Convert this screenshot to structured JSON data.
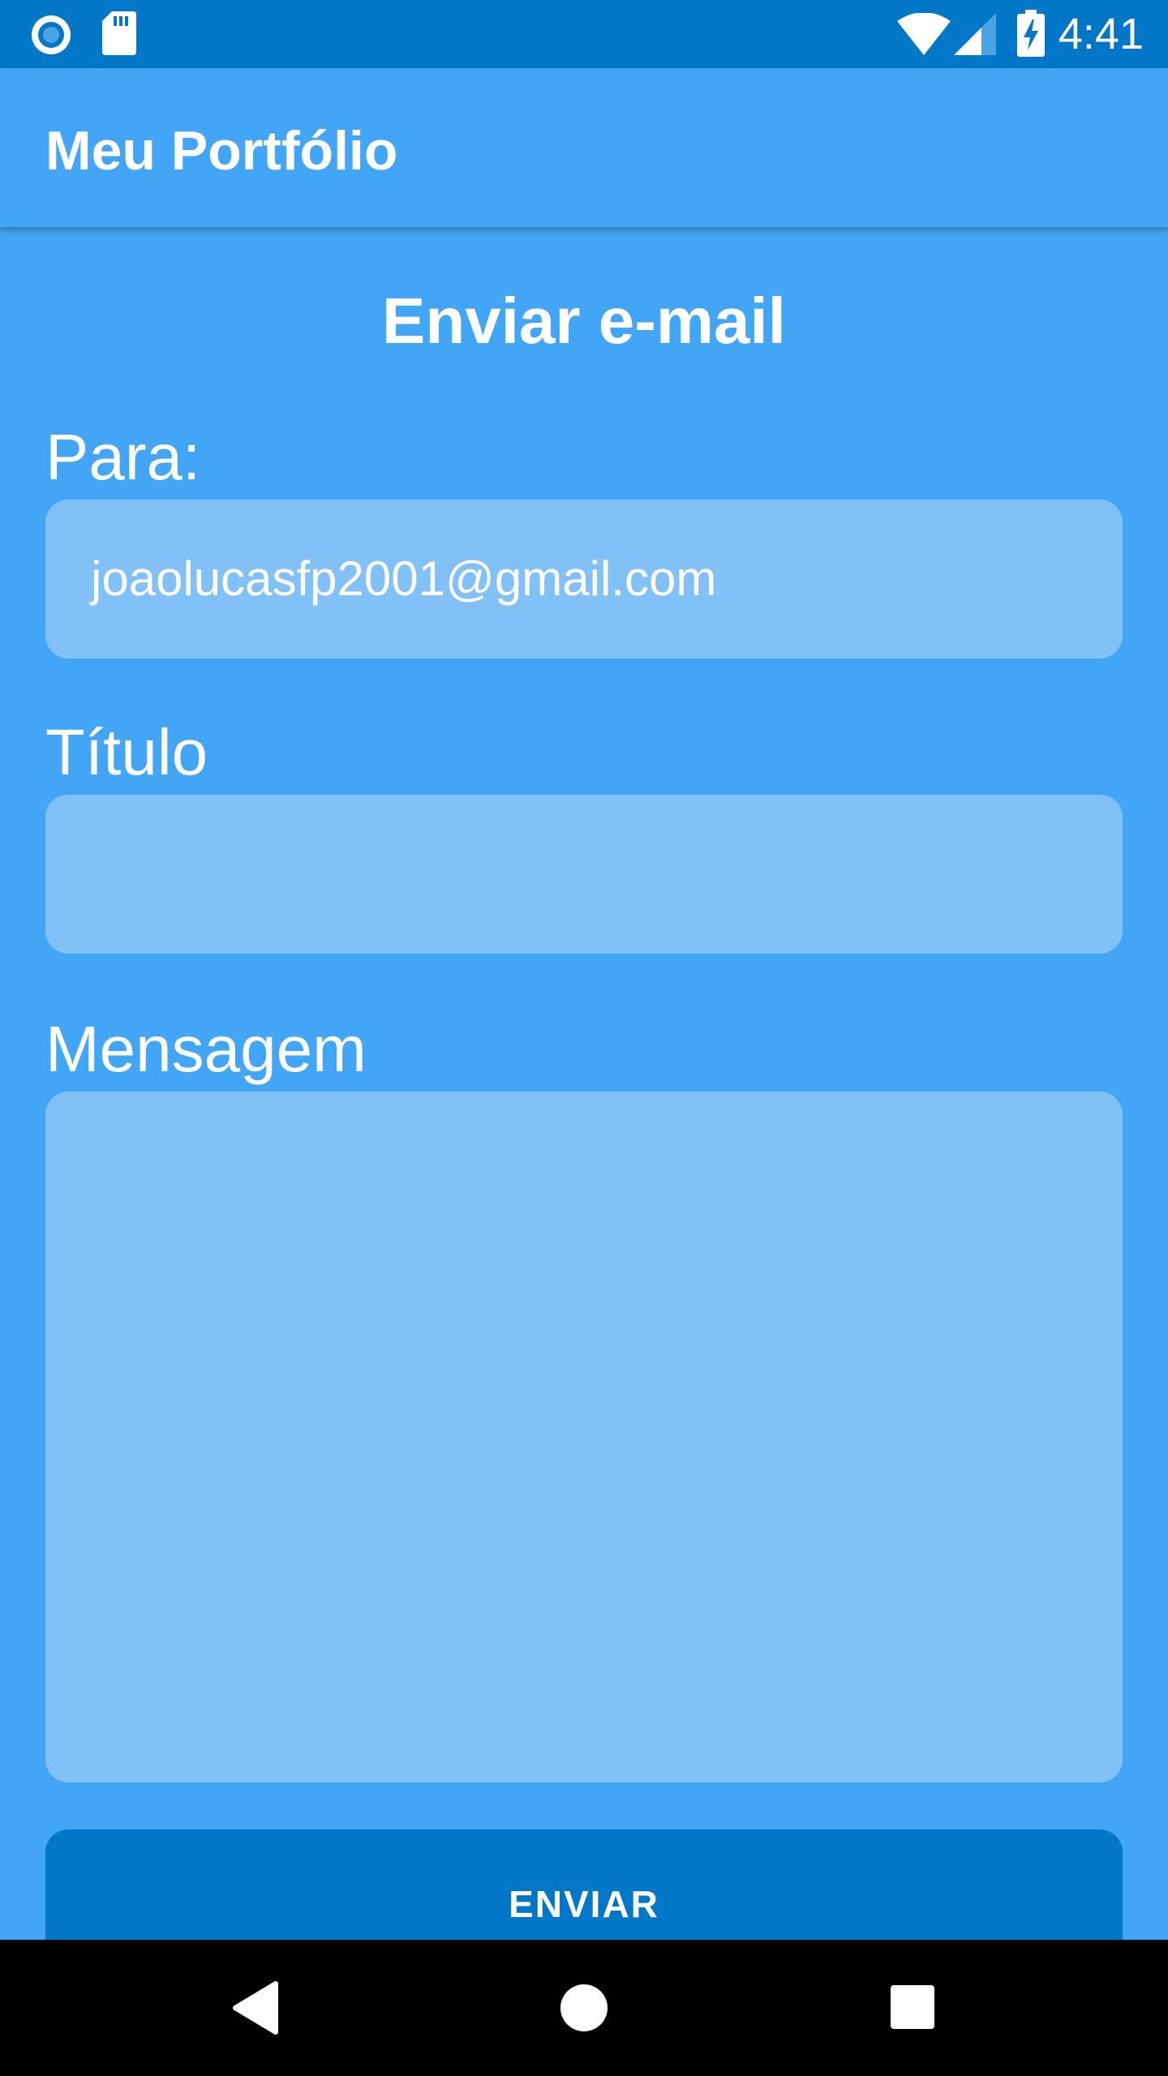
{
  "status_bar": {
    "time": "4:41",
    "icons": [
      "radio-icon",
      "sd-card-icon",
      "wifi-icon",
      "signal-icon",
      "battery-charging-icon"
    ]
  },
  "app_bar": {
    "title": "Meu Portfólio"
  },
  "form": {
    "heading": "Enviar e-mail",
    "to_label": "Para:",
    "to_value": "joaolucasfp2001@gmail.com",
    "title_label": "Título",
    "title_value": "",
    "message_label": "Mensagem",
    "message_value": "",
    "send_label": "ENVIAR"
  },
  "nav_bar": {
    "icons": [
      "back-icon",
      "home-icon",
      "recents-icon"
    ]
  },
  "colors": {
    "background": "#42a5f5",
    "status_bar": "#0277c8",
    "field": "#81c1f7",
    "button": "#0277c8",
    "nav_bar": "#000000"
  }
}
